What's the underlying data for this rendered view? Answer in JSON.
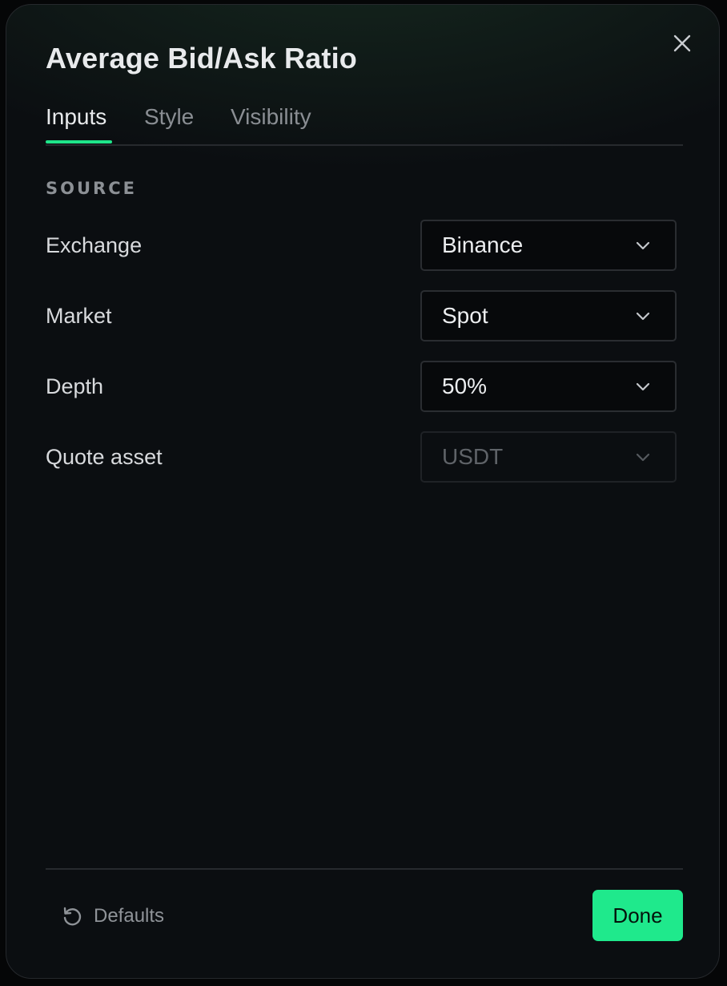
{
  "dialog": {
    "title": "Average Bid/Ask Ratio",
    "close_icon": "close-icon"
  },
  "tabs": [
    {
      "label": "Inputs",
      "active": true
    },
    {
      "label": "Style",
      "active": false
    },
    {
      "label": "Visibility",
      "active": false
    }
  ],
  "section": {
    "label": "SOURCE"
  },
  "fields": [
    {
      "label": "Exchange",
      "value": "Binance",
      "disabled": false,
      "icon": "chevron-down-icon"
    },
    {
      "label": "Market",
      "value": "Spot",
      "disabled": false,
      "icon": "chevron-down-icon"
    },
    {
      "label": "Depth",
      "value": "50%",
      "disabled": false,
      "icon": "chevron-down-icon"
    },
    {
      "label": "Quote asset",
      "value": "USDT",
      "disabled": true,
      "icon": "chevron-down-icon"
    }
  ],
  "footer": {
    "defaults_label": "Defaults",
    "defaults_icon": "reset-icon",
    "done_label": "Done"
  },
  "colors": {
    "accent": "#1fe58a",
    "background": "#0b0e11",
    "text": "#e8eaec",
    "muted": "#8a8e93"
  }
}
